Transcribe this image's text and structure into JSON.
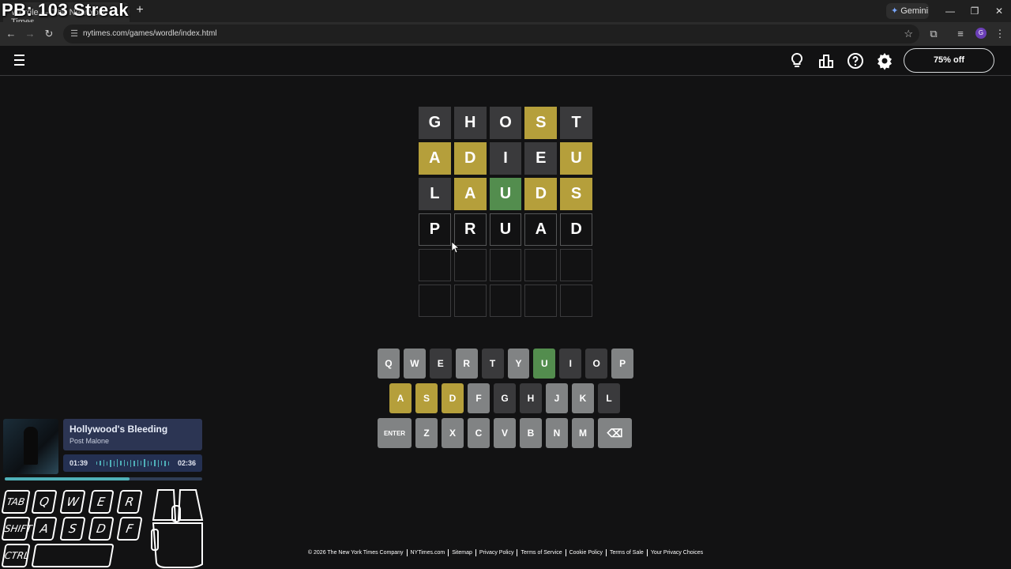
{
  "overlay": {
    "streak_title": "PB: 103 Streak"
  },
  "browser": {
    "tab_title": "Wordle — The New York Times",
    "new_tab_symbol": "+",
    "gemini_label": "Gemini",
    "url": "nytimes.com/games/wordle/index.html",
    "profile_initial": "G"
  },
  "header": {
    "offer_label": "75% off"
  },
  "board": {
    "rows": [
      [
        {
          "letter": "G",
          "state": "absent"
        },
        {
          "letter": "H",
          "state": "absent"
        },
        {
          "letter": "O",
          "state": "absent"
        },
        {
          "letter": "S",
          "state": "present"
        },
        {
          "letter": "T",
          "state": "absent"
        }
      ],
      [
        {
          "letter": "A",
          "state": "present"
        },
        {
          "letter": "D",
          "state": "present"
        },
        {
          "letter": "I",
          "state": "absent"
        },
        {
          "letter": "E",
          "state": "absent"
        },
        {
          "letter": "U",
          "state": "present"
        }
      ],
      [
        {
          "letter": "L",
          "state": "absent"
        },
        {
          "letter": "A",
          "state": "present"
        },
        {
          "letter": "U",
          "state": "correct"
        },
        {
          "letter": "D",
          "state": "present"
        },
        {
          "letter": "S",
          "state": "present"
        }
      ],
      [
        {
          "letter": "P",
          "state": "tbd"
        },
        {
          "letter": "R",
          "state": "tbd"
        },
        {
          "letter": "U",
          "state": "tbd"
        },
        {
          "letter": "A",
          "state": "tbd"
        },
        {
          "letter": "D",
          "state": "tbd"
        }
      ],
      [
        {
          "letter": "",
          "state": "empty"
        },
        {
          "letter": "",
          "state": "empty"
        },
        {
          "letter": "",
          "state": "empty"
        },
        {
          "letter": "",
          "state": "empty"
        },
        {
          "letter": "",
          "state": "empty"
        }
      ],
      [
        {
          "letter": "",
          "state": "empty"
        },
        {
          "letter": "",
          "state": "empty"
        },
        {
          "letter": "",
          "state": "empty"
        },
        {
          "letter": "",
          "state": "empty"
        },
        {
          "letter": "",
          "state": "empty"
        }
      ]
    ]
  },
  "keyboard": {
    "rows": [
      [
        {
          "k": "Q",
          "s": "unused"
        },
        {
          "k": "W",
          "s": "unused"
        },
        {
          "k": "E",
          "s": "absent"
        },
        {
          "k": "R",
          "s": "unused"
        },
        {
          "k": "T",
          "s": "absent"
        },
        {
          "k": "Y",
          "s": "unused"
        },
        {
          "k": "U",
          "s": "correct"
        },
        {
          "k": "I",
          "s": "absent"
        },
        {
          "k": "O",
          "s": "absent"
        },
        {
          "k": "P",
          "s": "unused"
        }
      ],
      [
        {
          "k": "A",
          "s": "present"
        },
        {
          "k": "S",
          "s": "present"
        },
        {
          "k": "D",
          "s": "present"
        },
        {
          "k": "F",
          "s": "unused"
        },
        {
          "k": "G",
          "s": "absent"
        },
        {
          "k": "H",
          "s": "absent"
        },
        {
          "k": "J",
          "s": "unused"
        },
        {
          "k": "K",
          "s": "unused"
        },
        {
          "k": "L",
          "s": "absent"
        }
      ],
      [
        {
          "k": "ENTER",
          "s": "unused",
          "wide": true
        },
        {
          "k": "Z",
          "s": "unused"
        },
        {
          "k": "X",
          "s": "unused"
        },
        {
          "k": "C",
          "s": "unused"
        },
        {
          "k": "V",
          "s": "unused"
        },
        {
          "k": "B",
          "s": "unused"
        },
        {
          "k": "N",
          "s": "unused"
        },
        {
          "k": "M",
          "s": "unused"
        },
        {
          "k": "⌫",
          "s": "unused",
          "wide": true
        }
      ]
    ]
  },
  "music": {
    "title": "Hollywood's Bleeding",
    "artist": "Post Malone",
    "elapsed": "01:39",
    "duration": "02:36",
    "progress_fraction": 0.63
  },
  "input_overlay": {
    "keys": [
      "TAB",
      "Q",
      "W",
      "E",
      "R",
      "SHIFT",
      "A",
      "S",
      "D",
      "F",
      "CTRL"
    ]
  },
  "footer": {
    "links": [
      "© 2026 The New York Times Company",
      "NYTimes.com",
      "Sitemap",
      "Privacy Policy",
      "Terms of Service",
      "Cookie Policy",
      "Terms of Sale",
      "Your Privacy Choices"
    ]
  },
  "colors": {
    "correct": "#538d4e",
    "present": "#b59f3b",
    "absent": "#3a3a3c",
    "unused_key": "#818384",
    "background": "#121213"
  }
}
